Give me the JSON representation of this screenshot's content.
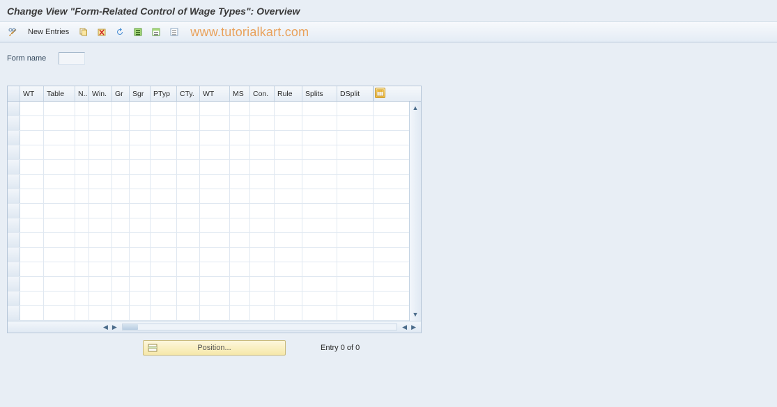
{
  "title": "Change View \"Form-Related Control of Wage Types\": Overview",
  "toolbar": {
    "new_entries_label": "New Entries"
  },
  "watermark": "www.tutorialkart.com",
  "form": {
    "form_name_label": "Form name",
    "form_name_value": ""
  },
  "grid": {
    "columns": [
      "WT",
      "Table",
      "N..",
      "Win.",
      "Gr",
      "Sgr",
      "PTyp",
      "CTy.",
      "WT",
      "MS",
      "Con.",
      "Rule",
      "Splits",
      "DSplit"
    ],
    "rows": [
      [
        "",
        "",
        "",
        "",
        "",
        "",
        "",
        "",
        "",
        "",
        "",
        "",
        "",
        ""
      ],
      [
        "",
        "",
        "",
        "",
        "",
        "",
        "",
        "",
        "",
        "",
        "",
        "",
        "",
        ""
      ],
      [
        "",
        "",
        "",
        "",
        "",
        "",
        "",
        "",
        "",
        "",
        "",
        "",
        "",
        ""
      ],
      [
        "",
        "",
        "",
        "",
        "",
        "",
        "",
        "",
        "",
        "",
        "",
        "",
        "",
        ""
      ],
      [
        "",
        "",
        "",
        "",
        "",
        "",
        "",
        "",
        "",
        "",
        "",
        "",
        "",
        ""
      ],
      [
        "",
        "",
        "",
        "",
        "",
        "",
        "",
        "",
        "",
        "",
        "",
        "",
        "",
        ""
      ],
      [
        "",
        "",
        "",
        "",
        "",
        "",
        "",
        "",
        "",
        "",
        "",
        "",
        "",
        ""
      ],
      [
        "",
        "",
        "",
        "",
        "",
        "",
        "",
        "",
        "",
        "",
        "",
        "",
        "",
        ""
      ],
      [
        "",
        "",
        "",
        "",
        "",
        "",
        "",
        "",
        "",
        "",
        "",
        "",
        "",
        ""
      ],
      [
        "",
        "",
        "",
        "",
        "",
        "",
        "",
        "",
        "",
        "",
        "",
        "",
        "",
        ""
      ],
      [
        "",
        "",
        "",
        "",
        "",
        "",
        "",
        "",
        "",
        "",
        "",
        "",
        "",
        ""
      ],
      [
        "",
        "",
        "",
        "",
        "",
        "",
        "",
        "",
        "",
        "",
        "",
        "",
        "",
        ""
      ],
      [
        "",
        "",
        "",
        "",
        "",
        "",
        "",
        "",
        "",
        "",
        "",
        "",
        "",
        ""
      ],
      [
        "",
        "",
        "",
        "",
        "",
        "",
        "",
        "",
        "",
        "",
        "",
        "",
        "",
        ""
      ],
      [
        "",
        "",
        "",
        "",
        "",
        "",
        "",
        "",
        "",
        "",
        "",
        "",
        "",
        ""
      ]
    ]
  },
  "position_button_label": "Position...",
  "entry_count": "Entry 0 of 0"
}
